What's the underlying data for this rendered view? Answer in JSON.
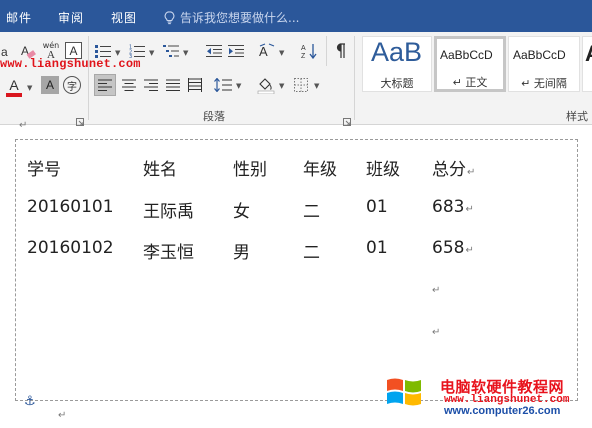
{
  "menubar": {
    "tabs": [
      {
        "label": "邮件"
      },
      {
        "label": "审阅"
      },
      {
        "label": "视图"
      }
    ],
    "tell_me_placeholder": "告诉我您想要做什么...",
    "background": "#2b579a"
  },
  "ribbon": {
    "watermark_url": "www.liangshunet.com",
    "paragraph_group_label": "段落",
    "styles_group_label": "样式",
    "font_tools": {
      "phonetic_label": "wén",
      "phonetic_sub": "A",
      "border_char": "A",
      "shade_char": "A",
      "enclose_char": "字",
      "font_color_char": "A"
    },
    "styles": [
      {
        "sample": "AaB",
        "name": "大标题",
        "active": false
      },
      {
        "sample": "AaBbCcD",
        "name": "↵ 正文",
        "active": true
      },
      {
        "sample": "AaBbCcD",
        "name": "↵ 无间隔",
        "active": false
      }
    ],
    "partial_style_sample": "A"
  },
  "document": {
    "top_para_mark": "↵",
    "table": {
      "headers": [
        "学号",
        "姓名",
        "性别",
        "年级",
        "班级",
        "总分"
      ],
      "rows": [
        [
          "20160101",
          "王际禹",
          "女",
          "二",
          "01",
          "683"
        ],
        [
          "20160102",
          "李玉恒",
          "男",
          "二",
          "01",
          "658"
        ]
      ],
      "row_end_mark": "↵"
    },
    "empty_para_marks": [
      "↵",
      "↵"
    ],
    "anchor_icon": "anchor-icon",
    "bottom_para_mark": "↵"
  },
  "watermark": {
    "title": "电脑软硬件教程网",
    "url1": "www.liangshunet.com",
    "url2": "www.computer26.com",
    "colors": {
      "red": "#e8131d",
      "blue": "#1c4fa8"
    }
  }
}
